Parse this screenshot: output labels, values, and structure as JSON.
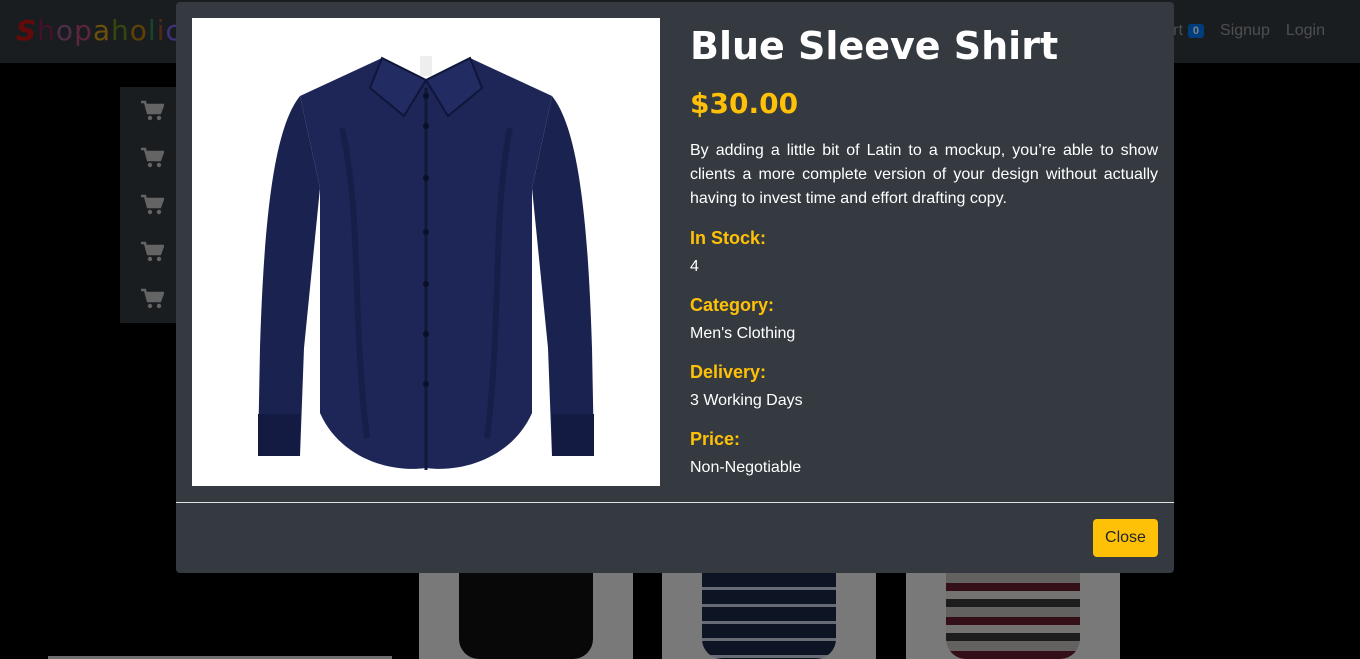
{
  "navbar": {
    "brand": "Shopaholic",
    "cart_label": "art",
    "cart_count": "0",
    "signup_label": "Signup",
    "login_label": "Login"
  },
  "sidebar": {
    "items": [
      {
        "icon": "cart-icon"
      },
      {
        "icon": "cart-icon"
      },
      {
        "icon": "cart-icon"
      },
      {
        "icon": "cart-icon"
      },
      {
        "icon": "cart-icon"
      }
    ]
  },
  "modal": {
    "title": "Blue Sleeve Shirt",
    "price": "$30.00",
    "description": "By adding a little bit of Latin to a mockup, you’re able to show clients a more complete version of your design without actually having to invest time and effort drafting copy.",
    "in_stock_label": "In Stock:",
    "in_stock_value": "4",
    "category_label": "Category:",
    "category_value": "Men's Clothing",
    "delivery_label": "Delivery:",
    "delivery_value": "3 Working Days",
    "price_label": "Price:",
    "price_value": "Non-Negotiable",
    "close_label": "Close"
  },
  "colors": {
    "accent": "#ffc107",
    "modal_bg": "#343a40",
    "shirt": "#1a2250"
  }
}
